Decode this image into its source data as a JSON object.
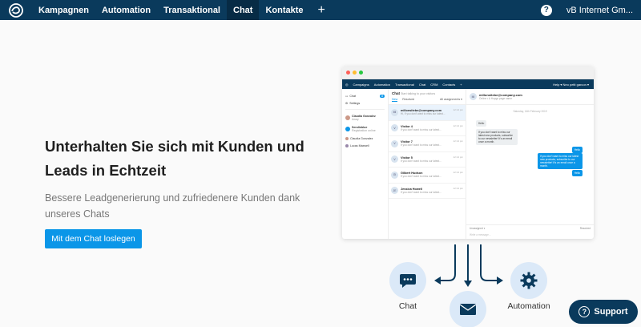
{
  "nav": {
    "items": [
      "Kampagnen",
      "Automation",
      "Transaktional",
      "Chat",
      "Kontakte"
    ],
    "active_index": 3,
    "plus": "+",
    "help": "?",
    "company": "vB Internet Gm..."
  },
  "hero": {
    "title": "Unterhalten Sie sich mit Kunden und Leads in Echtzeit",
    "subtitle": "Bessere Leadgenerierung und zufriedenere Kunden dank unseres Chats",
    "cta": "Mit dem Chat loslegen"
  },
  "mockup": {
    "nav": {
      "items": [
        "Campaigns",
        "Automation",
        "Transactional",
        "Chat",
        "CRM",
        "Contacts",
        "+"
      ],
      "right": "Help ▾   Neo petit garcon ▾"
    },
    "sidebar": {
      "chat_label": "Chat",
      "chat_badge": "8",
      "settings_label": "Settings",
      "agents": [
        "Claudia Gonzalez",
        "Sendinblue",
        "Claudia Gonzalez",
        "Lucas Maxwell"
      ],
      "agent_status": [
        "Away",
        "Registration online",
        "",
        ""
      ]
    },
    "list": {
      "title": "Chat",
      "subtitle": "Start talking to your visitors",
      "tab_new": "New",
      "tab_resolved": "Resolved",
      "tab_assign": "All assignments ▾",
      "items": [
        {
          "initials": "MI",
          "name": "millonsitebe@company.com",
          "preview": "Hi, If you don't want to miss our latest...",
          "time": "12:14 pm"
        },
        {
          "initials": "V",
          "name": "Visitor 4",
          "preview": "If you don't want to miss our latest...",
          "time": "12:14 pm"
        },
        {
          "initials": "V",
          "name": "Visitor 7",
          "preview": "If you don't want to miss our latest...",
          "time": "12:14 pm"
        },
        {
          "initials": "V",
          "name": "Visitor 5",
          "preview": "If you don't want to miss our latest...",
          "time": "12:14 pm"
        },
        {
          "initials": "GI",
          "name": "Gilbert Hudson",
          "preview": "If you don't want to miss our latest...",
          "time": "12:14 pm"
        },
        {
          "initials": "JE",
          "name": "Jessica Howell",
          "preview": "If you don't want to miss our latest...",
          "time": "12:14 pm"
        }
      ]
    },
    "conversation": {
      "initials": "MI",
      "email": "millonsitebe@company.com",
      "sub": "Online • A Hopgo page name",
      "date": "Saturday, 14th February 2019",
      "msg1": "Hello",
      "msg2": "If you don't want to miss our latest new products, subscribe to our newsletter! It's an email once a month.",
      "msg3": "Hello",
      "msg4": "If you don't want to miss our latest new products, subscribe to our newsletter! It's an email once a month.",
      "msg5": "Hello",
      "footer_assign": "Unassigned ▾",
      "footer_resolved": "Resolved",
      "footer_input": "Write a message..."
    }
  },
  "flow": {
    "chat_label": "Chat",
    "automation_label": "Automation"
  },
  "support": {
    "label": "Support",
    "icon": "?"
  },
  "colors": {
    "nav": "#0a3a5c",
    "accent": "#0b96e8",
    "circle": "#dbe9f8"
  }
}
